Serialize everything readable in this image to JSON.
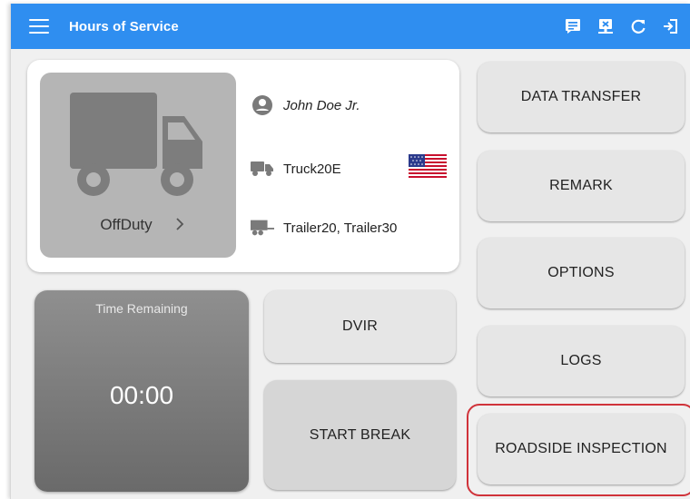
{
  "app_bar": {
    "title": "Hours of Service",
    "menu_icon": "hamburger-menu-icon",
    "actions": [
      "edit-notes-icon",
      "export-icon",
      "refresh-icon",
      "logout-icon"
    ]
  },
  "status_card": {
    "duty_status": "OffDuty",
    "driver_name": "John Doe Jr.",
    "vehicle": "Truck20E",
    "trailers": "Trailer20, Trailer30",
    "country_flag": "us-flag-icon"
  },
  "time_remaining": {
    "label": "Time Remaining",
    "value": "00:00"
  },
  "buttons": {
    "dvir": "DVIR",
    "start_break": "START BREAK",
    "data_transfer": "DATA TRANSFER",
    "remark": "REMARK",
    "options": "OPTIONS",
    "logs": "LOGS",
    "roadside_inspection": "ROADSIDE INSPECTION"
  },
  "colors": {
    "app_bar": "#2f8ef0",
    "highlight": "#d0333a"
  }
}
